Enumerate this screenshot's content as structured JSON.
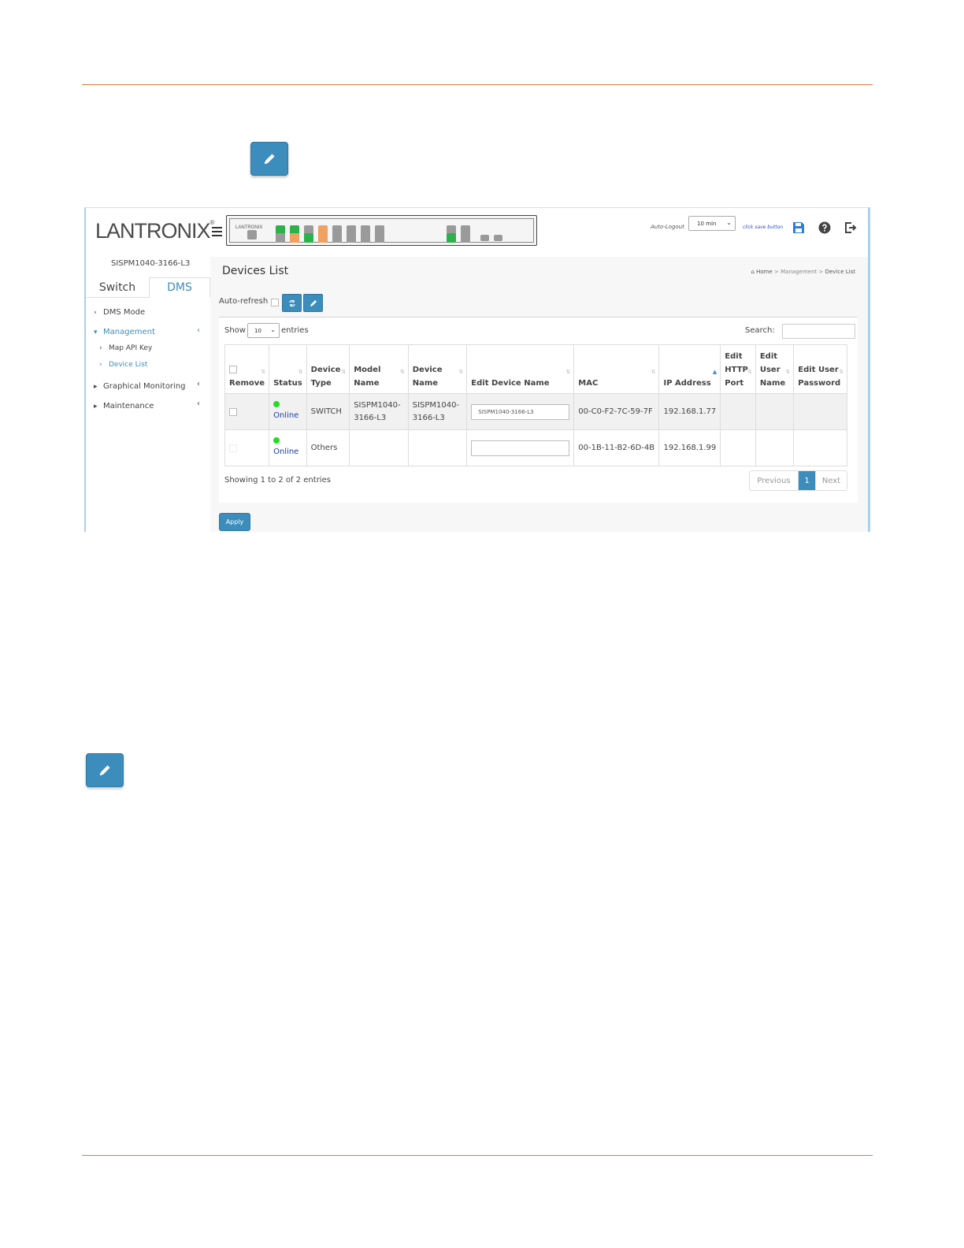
{
  "page": {
    "colors": {
      "rule": "#e07a3c",
      "accent": "#3c8dbc",
      "online_dot": "#22dd22"
    },
    "icons": {
      "edit_button_top": "pencil-icon",
      "edit_button_bottom": "pencil-icon"
    }
  },
  "app": {
    "logo_text": "LANTRONIX",
    "logo_mark": "®",
    "device_panel_logo": "LANTRONIX",
    "auto_logout_label": "Auto-Logout",
    "auto_logout_value": "10 min",
    "save_hint": "click save button",
    "device_name": "SISPM1040-3166-L3"
  },
  "sidebar": {
    "tabs": [
      {
        "label": "Switch"
      },
      {
        "label": "DMS"
      }
    ],
    "items": [
      {
        "label": "DMS Mode"
      },
      {
        "label": "Management"
      },
      {
        "label": "Map API Key"
      },
      {
        "label": "Device List"
      },
      {
        "label": "Graphical Monitoring"
      },
      {
        "label": "Maintenance"
      }
    ]
  },
  "main": {
    "title": "Devices List",
    "breadcrumb": {
      "home": "Home",
      "section": "Management",
      "page": "Device List"
    },
    "auto_refresh_label": "Auto-refresh",
    "show_label": "Show",
    "entries_value": "10",
    "entries_label": "entries",
    "search_label": "Search:",
    "search_value": "",
    "columns": [
      "Remove",
      "Status",
      "Device Type",
      "Model Name",
      "Device Name",
      "Edit Device Name",
      "MAC",
      "IP Address",
      "Edit HTTP Port",
      "Edit User Name",
      "Edit User Password"
    ],
    "rows": [
      {
        "status": "Online",
        "device_type": "SWITCH",
        "model_name": "SISPM1040-3166-L3",
        "device_name": "SISPM1040-3166-L3",
        "edit_device_name": "SISPM1040-3166-L3",
        "mac": "00-C0-F2-7C-59-7F",
        "ip": "192.168.1.77"
      },
      {
        "status": "Online",
        "device_type": "Others",
        "model_name": "",
        "device_name": "",
        "edit_device_name": "",
        "mac": "00-1B-11-B2-6D-4B",
        "ip": "192.168.1.99"
      }
    ],
    "info": "Showing 1 to 2 of 2 entries",
    "pagination": {
      "prev": "Previous",
      "current": "1",
      "next": "Next"
    },
    "apply_label": "Apply"
  }
}
